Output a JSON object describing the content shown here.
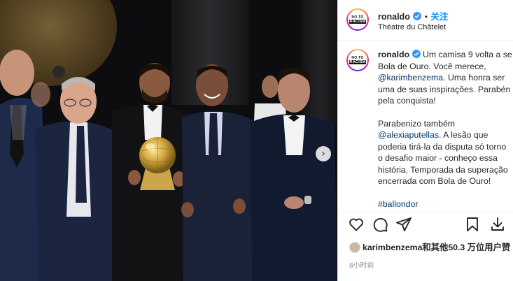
{
  "post": {
    "author": "ronaldo",
    "follow_label": "关注",
    "separator": "•",
    "location": "Théatre du Châtelet",
    "avatar_text_line1": "NO TO",
    "avatar_text_line2": "RACISM",
    "caption": {
      "author": "ronaldo",
      "lines_p1": [
        "Um camisa 9 volta a se",
        "Bola de Ouro. Você merece,",
        "@karimbenzema",
        ". Uma honra ser",
        "uma de suas inspirações. Parabén",
        "pela conquista!"
      ],
      "lines_p2": [
        "Parabenizo também",
        "@alexiaputellas",
        ". A lesão que",
        "poderia tirá-la da disputa só torno",
        "o desafio maior - conheço essa",
        "história. Temporada da superação",
        "encerrada com Bola de Ouro!"
      ],
      "hashtag": "#ballondor"
    },
    "likes_text": "karimbenzema和其他50.3 万位用户赞",
    "time_ago": "8小时前"
  },
  "colors": {
    "link": "#00376b",
    "follow": "#0095f6",
    "verified": "#3897f0"
  },
  "icons": [
    "heart-icon",
    "comment-icon",
    "share-icon",
    "bookmark-icon",
    "download-icon",
    "verified-badge-icon",
    "carousel-next-icon"
  ],
  "carousel_next_glyph": "›"
}
